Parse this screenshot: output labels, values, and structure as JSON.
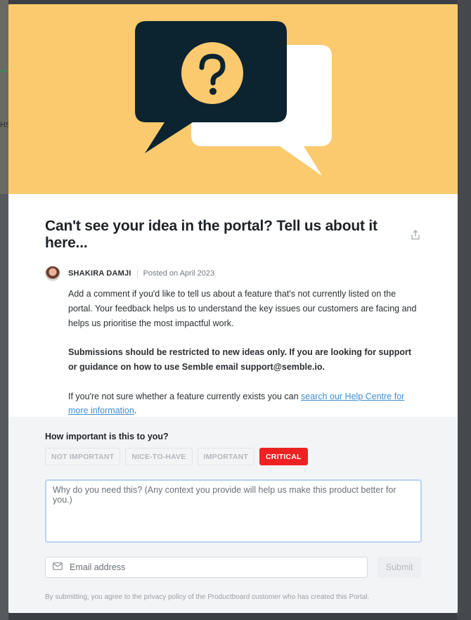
{
  "backdrop": {
    "fragment": "HS"
  },
  "post": {
    "title": "Can't see your idea in the portal? Tell us about it here...",
    "author": "SHAKIRA DAMJI",
    "posted": "Posted on April 2023",
    "paragraph1": "Add a comment if you'd like to tell us about a feature that's not currently listed on the portal. Your feedback helps us to understand the key issues our customers are facing and helps us prioritise the most impactful work.",
    "paragraph2": "Submissions should be restricted to new ideas only. If you are looking for support or guidance on how to use Semble email support@semble.io.",
    "paragraph3_prefix": "If you're not sure whether a feature currently exists you can ",
    "paragraph3_link": "search our Help Centre for more information",
    "paragraph3_suffix": "."
  },
  "feedback": {
    "question": "How important is this to you?",
    "options": [
      {
        "label": "NOT IMPORTANT",
        "selected": false
      },
      {
        "label": "NICE-TO-HAVE",
        "selected": false
      },
      {
        "label": "IMPORTANT",
        "selected": false
      },
      {
        "label": "CRITICAL",
        "selected": true
      }
    ],
    "textarea_placeholder": "Why do you need this? (Any context you provide will help us make this product better for you.)",
    "email_placeholder": "Email address",
    "submit_label": "Submit",
    "legal": "By submitting, you agree to the privacy policy of the Productboard customer who has created this Portal."
  },
  "icons": {
    "hero": "question-speech-bubbles-icon",
    "share": "share-icon",
    "email": "envelope-icon"
  },
  "colors": {
    "hero_bg": "#fcca6e",
    "bubble_dark": "#0c2330",
    "critical": "#ee2222",
    "link": "#3d8fd6"
  }
}
